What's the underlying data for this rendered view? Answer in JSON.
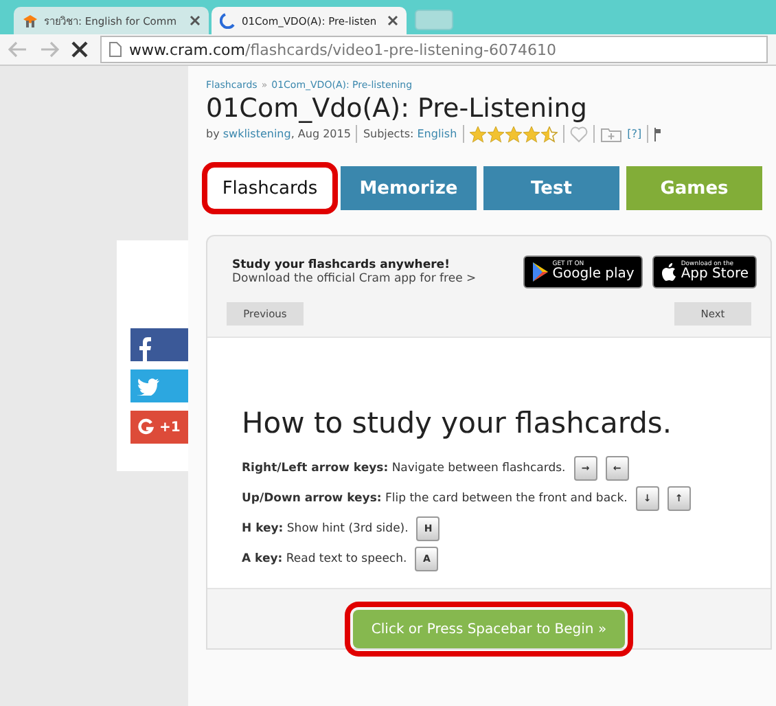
{
  "browser": {
    "tabs": [
      {
        "title": "รายวิชา: English for Comm",
        "selected": false,
        "kind": "moodle"
      },
      {
        "title": "01Com_VDO(A): Pre-listen",
        "selected": true,
        "kind": "loading"
      }
    ],
    "url_host": "www.cram.com",
    "url_path": "/flashcards/video1-pre-listening-6074610"
  },
  "breadcrumb": {
    "items": [
      "Flashcards",
      "01Com_VDO(A): Pre-listening"
    ],
    "separator": "»"
  },
  "title": "01Com_Vdo(A): Pre-Listening",
  "meta": {
    "by": "by",
    "author": "swklistening",
    "date": ", Aug 2015",
    "subjects_label": "Subjects:",
    "subject": "English",
    "stars": 4.5,
    "folder_link": "[?]"
  },
  "tabs": [
    {
      "label": "Flashcards",
      "selected": true,
      "highlighted": true,
      "color": "#ffffff"
    },
    {
      "label": "Memorize",
      "selected": false,
      "highlighted": false,
      "color": "#3a87ad"
    },
    {
      "label": "Test",
      "selected": false,
      "highlighted": false,
      "color": "#3a87ad"
    },
    {
      "label": "Games",
      "selected": false,
      "highlighted": false,
      "color": "#82ad38"
    }
  ],
  "share": [
    {
      "kind": "facebook"
    },
    {
      "kind": "twitter"
    },
    {
      "kind": "google",
      "label": "+1"
    }
  ],
  "promo": {
    "headline": "Study your flashcards anywhere!",
    "text": "Download the official Cram app for free >",
    "google": {
      "small": "GET IT ON",
      "big": "Google play"
    },
    "apple": {
      "small": "Download on the",
      "big": "App Store"
    }
  },
  "nav": {
    "previous": "Previous",
    "next": "Next"
  },
  "howto": {
    "heading": "How to study your flashcards.",
    "lines": [
      {
        "key": "Right/Left arrow keys:",
        "text": "Navigate between flashcards.",
        "caps": [
          "→",
          "←"
        ]
      },
      {
        "key": "Up/Down arrow keys:",
        "text": "Flip the card between the front and back.",
        "caps": [
          "↓",
          "↑"
        ]
      },
      {
        "key": "H key:",
        "text": "Show hint (3rd side).",
        "caps": [
          "H"
        ]
      },
      {
        "key": "A key:",
        "text": "Read text to speech.",
        "caps": [
          "A"
        ]
      }
    ]
  },
  "begin": {
    "label": "Click or Press Spacebar to Begin »",
    "highlighted": true
  }
}
